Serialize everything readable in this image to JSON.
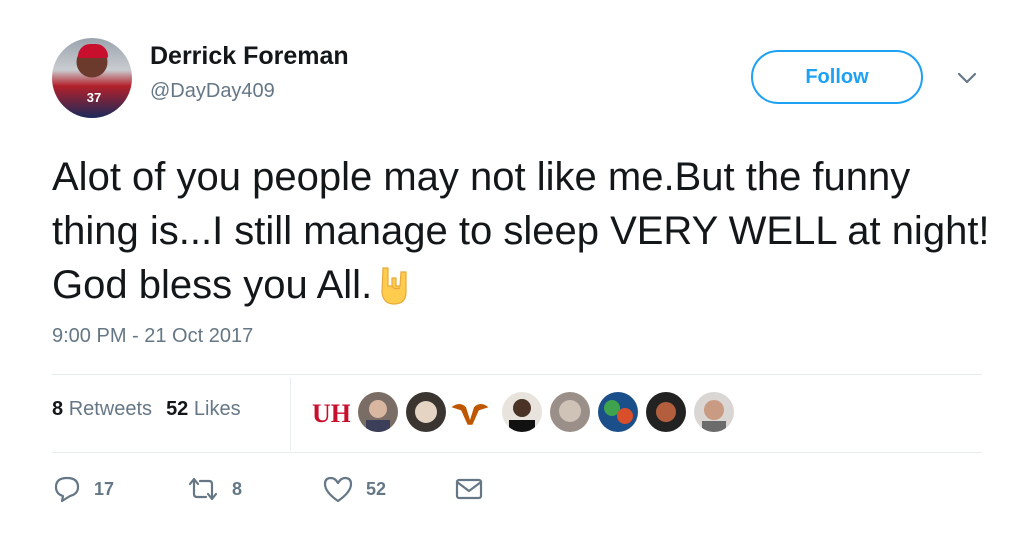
{
  "author": {
    "name": "Derrick Foreman",
    "handle": "@DayDay409",
    "avatar_jersey_number": "37"
  },
  "follow_label": "Follow",
  "tweet": {
    "text": "Alot of you people may not like me.But the funny thing is...I still manage to sleep VERY WELL at night! God bless you All.",
    "emoji": "sign-of-the-horns-emoji",
    "timestamp": "9:00 PM - 21 Oct 2017"
  },
  "stats": {
    "retweets_count": "8",
    "retweets_label": "Retweets",
    "likes_count": "52",
    "likes_label": "Likes"
  },
  "actions": {
    "reply_count": "17",
    "retweet_count": "8",
    "like_count": "52"
  },
  "colors": {
    "accent": "#1da1f2",
    "secondary_text": "#657786",
    "primary_text": "#14171a"
  }
}
